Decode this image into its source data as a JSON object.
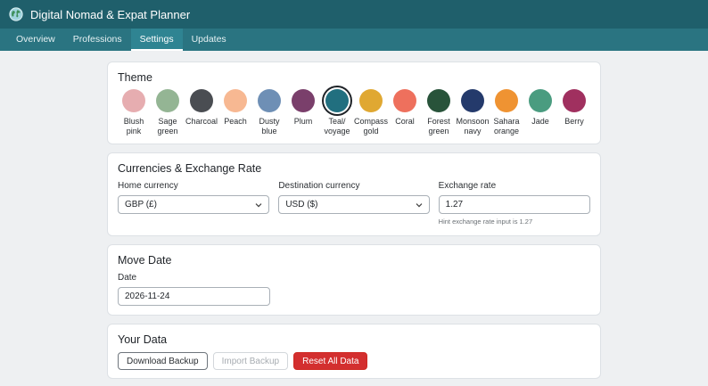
{
  "app": {
    "title": "Digital Nomad & Expat Planner",
    "logo_icon": "globe-icon"
  },
  "tabs": [
    {
      "label": "Overview"
    },
    {
      "label": "Professions"
    },
    {
      "label": "Settings"
    },
    {
      "label": "Updates"
    }
  ],
  "active_tab": "Settings",
  "theme": {
    "title": "Theme",
    "selected": "Teal/ voyage",
    "swatches": [
      {
        "label": "Blush pink",
        "color": "#e6adb0"
      },
      {
        "label": "Sage green",
        "color": "#94b594"
      },
      {
        "label": "Charcoal",
        "color": "#4a4d52"
      },
      {
        "label": "Peach",
        "color": "#f7b892"
      },
      {
        "label": "Dusty blue",
        "color": "#6e8fb5"
      },
      {
        "label": "Plum",
        "color": "#7a3f6b"
      },
      {
        "label": "Teal/ voyage",
        "color": "#216f7f"
      },
      {
        "label": "Compass gold",
        "color": "#e0a832"
      },
      {
        "label": "Coral",
        "color": "#ee705d"
      },
      {
        "label": "Forest green",
        "color": "#28533a"
      },
      {
        "label": "Monsoon navy",
        "color": "#243a6b"
      },
      {
        "label": "Sahara orange",
        "color": "#ef9332"
      },
      {
        "label": "Jade",
        "color": "#4a9c80"
      },
      {
        "label": "Berry",
        "color": "#a0305f"
      }
    ]
  },
  "currencies": {
    "title": "Currencies & Exchange Rate",
    "home_label": "Home currency",
    "home_value": "GBP (£)",
    "dest_label": "Destination currency",
    "dest_value": "USD ($)",
    "rate_label": "Exchange rate",
    "rate_value": "1.27",
    "rate_hint": "Hint exchange rate input is 1.27"
  },
  "move_date": {
    "title": "Move Date",
    "date_label": "Date",
    "date_value": "2026-11-24"
  },
  "your_data": {
    "title": "Your Data",
    "download_label": "Download Backup",
    "import_label": "Import Backup",
    "reset_label": "Reset All Data"
  },
  "colors": {
    "header_bg": "#1f5f6b",
    "tabs_bg": "#2a7481",
    "danger": "#d32f2f"
  }
}
